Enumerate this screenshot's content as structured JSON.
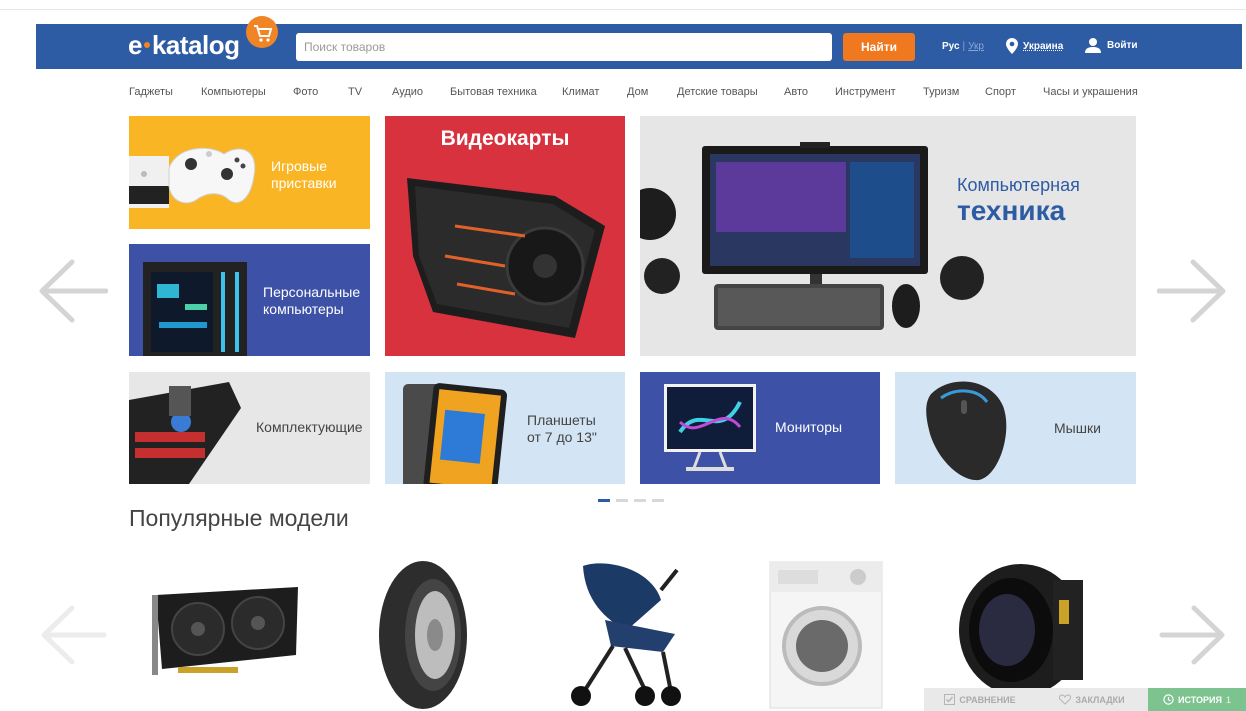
{
  "header": {
    "logo_text": "e·katalog",
    "search_placeholder": "Поиск товаров",
    "find_label": "Найти",
    "lang_current": "Рус",
    "lang_sep": "|",
    "lang_other": "Укр",
    "region": "Украина",
    "login": "Войти"
  },
  "categories": [
    "Гаджеты",
    "Компьютеры",
    "Фото",
    "TV",
    "Аудио",
    "Бытовая техника",
    "Климат",
    "Дом",
    "Детские товары",
    "Авто",
    "Инструмент",
    "Туризм",
    "Спорт",
    "Часы и украшения"
  ],
  "tiles": {
    "consoles": "Игровые приставки",
    "pc_line1": "Персональные",
    "pc_line2": "компьютеры",
    "gpu": "Видеокарты",
    "comp_line1": "Компьютерная",
    "comp_line2": "техника",
    "parts": "Комплектующие",
    "tablets_line1": "Планшеты",
    "tablets_line2": "от 7 до 13\"",
    "monitors": "Мониторы",
    "mice": "Мышки"
  },
  "popular_title": "Популярные модели",
  "bottom_bar": {
    "compare": "СРАВНЕНИЕ",
    "bookmarks": "ЗАКЛАДКИ",
    "history": "ИСТОРИЯ",
    "history_count": "1"
  },
  "colors": {
    "header_bg": "#2e5ca4",
    "accent_orange": "#f0781f",
    "history_green": "#7dc38f"
  }
}
